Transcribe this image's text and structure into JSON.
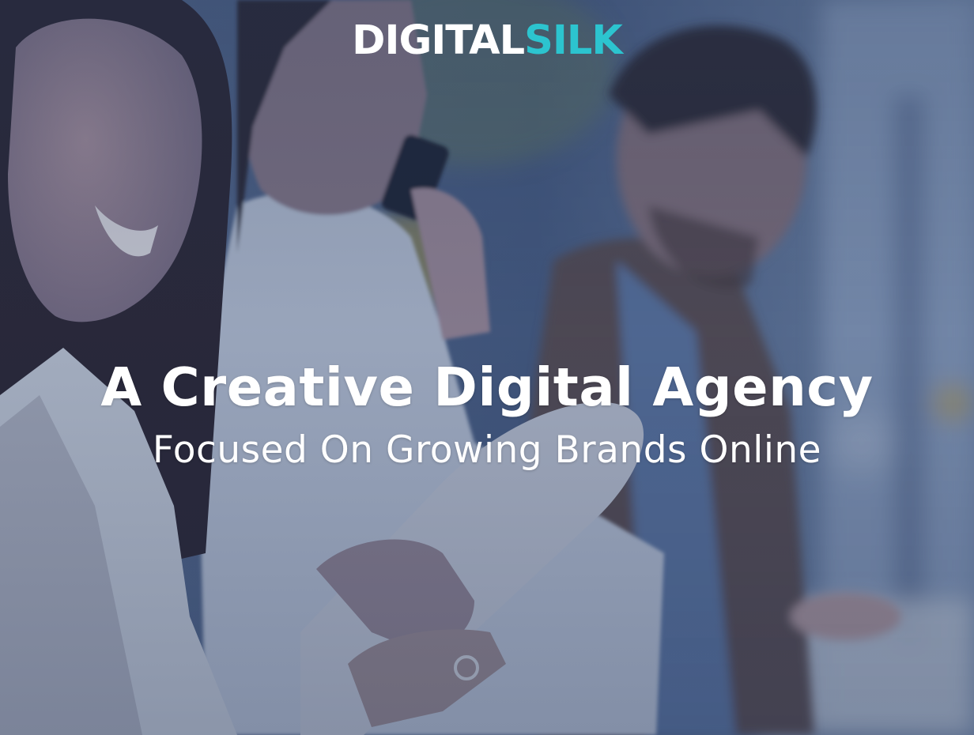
{
  "logo": {
    "primary": "DIGITAL",
    "accent": "SILK",
    "accent_color": "#2cc4cf"
  },
  "hero": {
    "title": "A Creative Digital Agency",
    "subtitle": "Focused On Growing Brands Online",
    "overlay_color": "#2b4270"
  }
}
